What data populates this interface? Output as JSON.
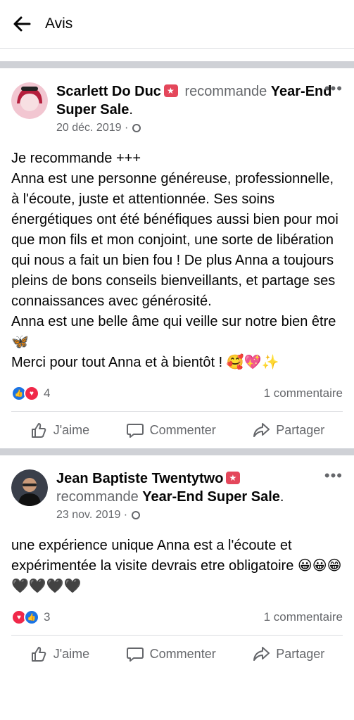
{
  "topbar": {
    "title": "Avis"
  },
  "posts": [
    {
      "author": "Scarlett Do Duc",
      "action": "recommande",
      "page": "Year-End Super Sale",
      "date": "20 déc. 2019",
      "body": "Je recommande +++\nAnna est une personne généreuse, professionnelle, à l'écoute, juste et attentionnée. Ses soins énergétiques ont été bénéfiques aussi bien pour moi que mon fils et mon conjoint, une sorte de libération qui nous a fait un bien fou ! De plus Anna a toujours pleins de bons conseils bienveillants, et partage ses connaissances avec générosité.\nAnna est une belle âme qui veille sur notre bien être 🦋\nMerci pour tout Anna et à bientôt ! 🥰💖✨",
      "reactions": "4",
      "comments": "1 commentaire"
    },
    {
      "author": "Jean Baptiste Twentytwo",
      "action": "recommande",
      "page": "Year-End Super Sale",
      "date": "23 nov. 2019",
      "body": "une expérience  unique  Anna est a l'écoute et expérimentée la visite devrais etre obligatoire 😀😀😁🖤🖤🖤🖤",
      "reactions": "3",
      "comments": "1 commentaire"
    }
  ],
  "actions": {
    "like": "J'aime",
    "comment": "Commenter",
    "share": "Partager"
  }
}
